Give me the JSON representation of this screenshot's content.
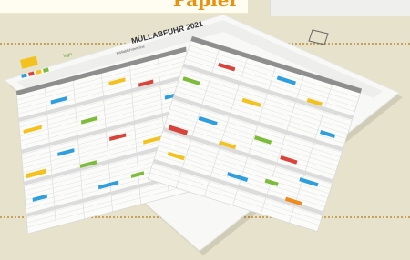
{
  "header": {
    "tab_title": "Papier"
  },
  "poster": {
    "title": "MÜLLABFUHR 2021",
    "subtitle": "Müllabfuhrtermine",
    "colors": {
      "paper": "#f8f8f6",
      "grid": "#d4d4d2",
      "header_gray": "#8e8e8e",
      "blue": "#2e9fdc",
      "yellow": "#f4c21d",
      "green": "#7dbb3a",
      "red": "#d8433a",
      "orange": "#ef8a1c"
    }
  }
}
